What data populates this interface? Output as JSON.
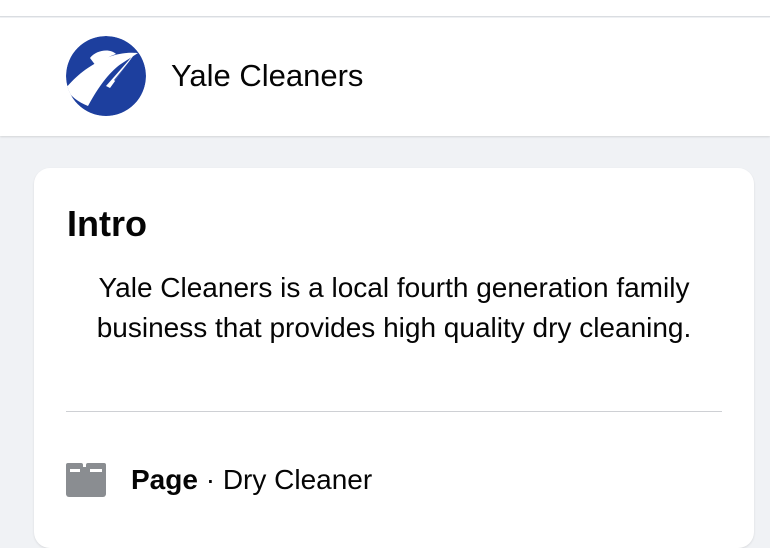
{
  "header": {
    "page_name": "Yale Cleaners",
    "avatar_icon": "yale-cleaners-logo-icon",
    "avatar_color": "#1d3f9e"
  },
  "intro": {
    "title": "Intro",
    "bio": "Yale Cleaners is a local fourth generation family business that provides high quality dry cleaning.",
    "info": {
      "icon": "page-folder-icon",
      "label": "Page",
      "separator": " · ",
      "category": "Dry Cleaner"
    }
  },
  "colors": {
    "background": "#f0f2f5",
    "card": "#ffffff",
    "text": "#050505",
    "icon_gray": "#8a8d91",
    "divider": "#ced0d4"
  }
}
